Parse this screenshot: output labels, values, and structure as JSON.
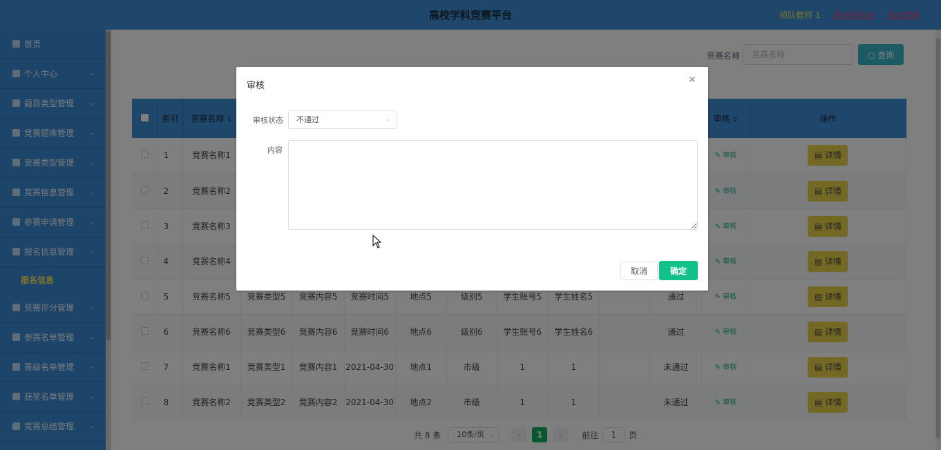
{
  "header": {
    "title": "高校学科竞赛平台",
    "user": "领队教师 1",
    "link_front": "退出到前台",
    "link_logout": "退出登录"
  },
  "sidebar": {
    "items": [
      {
        "label": "首页",
        "icon": "home-icon",
        "caret": ""
      },
      {
        "label": "个人中心",
        "icon": "user-icon",
        "caret": "⌄"
      },
      {
        "label": "题目类型管理",
        "icon": "folder-icon",
        "caret": "⌄"
      },
      {
        "label": "竞赛题库管理",
        "icon": "folder-icon",
        "caret": "⌄"
      },
      {
        "label": "竞赛类型管理",
        "icon": "folder-icon",
        "caret": "⌄"
      },
      {
        "label": "竞赛信息管理",
        "icon": "send-icon",
        "caret": "⌄"
      },
      {
        "label": "参赛申请管理",
        "icon": "list-icon",
        "caret": "⌄"
      },
      {
        "label": "报名信息管理",
        "icon": "folder-icon",
        "caret": "⌄"
      }
    ],
    "sub_item": "报名信息",
    "items_after": [
      {
        "label": "竞赛评分管理",
        "icon": "trophy-icon",
        "caret": "⌄"
      },
      {
        "label": "参赛名单管理",
        "icon": "circle-icon",
        "caret": "⌄"
      },
      {
        "label": "晋级名单管理",
        "icon": "clock-icon",
        "caret": "⌄"
      },
      {
        "label": "获奖名单管理",
        "icon": "flag-icon",
        "caret": "⌄"
      },
      {
        "label": "竞赛总结管理",
        "icon": "folder-icon",
        "caret": "⌄"
      }
    ]
  },
  "search": {
    "label": "竞赛名称",
    "placeholder": "竞赛名称",
    "button": "查询"
  },
  "table": {
    "headers": {
      "index": "索引",
      "name": "竞赛名称",
      "audit": "审核",
      "action": "操作"
    },
    "audit_link": "审核",
    "detail_button": "详情",
    "rows": [
      {
        "idx": "1",
        "name": "竞赛名称1",
        "type": "",
        "content": "",
        "time": "",
        "place": "",
        "level": "",
        "account": "",
        "student": "",
        "extra": "",
        "status": ""
      },
      {
        "idx": "2",
        "name": "竞赛名称2",
        "type": "",
        "content": "",
        "time": "",
        "place": "",
        "level": "",
        "account": "",
        "student": "",
        "extra": "",
        "status": ""
      },
      {
        "idx": "3",
        "name": "竞赛名称3",
        "type": "",
        "content": "",
        "time": "",
        "place": "",
        "level": "",
        "account": "",
        "student": "",
        "extra": "",
        "status": ""
      },
      {
        "idx": "4",
        "name": "竞赛名称4",
        "type": "",
        "content": "",
        "time": "",
        "place": "",
        "level": "",
        "account": "",
        "student": "",
        "extra": "",
        "status": ""
      },
      {
        "idx": "5",
        "name": "竞赛名称5",
        "type": "竞赛类型5",
        "content": "竞赛内容5",
        "time": "竞赛时间5",
        "place": "地点5",
        "level": "级别5",
        "account": "学生账号5",
        "student": "学生姓名5",
        "extra": "",
        "status": "通过"
      },
      {
        "idx": "6",
        "name": "竞赛名称6",
        "type": "竞赛类型6",
        "content": "竞赛内容6",
        "time": "竞赛时间6",
        "place": "地点6",
        "level": "级别6",
        "account": "学生账号6",
        "student": "学生姓名6",
        "extra": "",
        "status": "通过"
      },
      {
        "idx": "7",
        "name": "竞赛名称1",
        "type": "竞赛类型1",
        "content": "竞赛内容1",
        "time": "2021-04-30",
        "place": "地点1",
        "level": "市级",
        "account": "1",
        "student": "1",
        "extra": "",
        "status": "未通过"
      },
      {
        "idx": "8",
        "name": "竞赛名称2",
        "type": "竞赛类型2",
        "content": "竞赛内容2",
        "time": "2021-04-30",
        "place": "地点2",
        "level": "市级",
        "account": "1",
        "student": "1",
        "extra": "",
        "status": "未通过"
      }
    ]
  },
  "pager": {
    "total": "共 8 条",
    "page_size": "10条/页",
    "current_page": "1",
    "goto_prefix": "前往",
    "goto_value": "1",
    "goto_suffix": "页"
  },
  "dialog": {
    "title": "审核",
    "status_label": "审核状态",
    "status_value": "不通过",
    "content_label": "内容",
    "content_value": "",
    "cancel": "取消",
    "ok": "确定"
  },
  "colors": {
    "header": "#3f8fd6",
    "sidebar": "#3a8ad2",
    "accent_green": "#13c18d",
    "detail_yellow": "#e7d34a",
    "search_btn": "#3bb7c9"
  }
}
